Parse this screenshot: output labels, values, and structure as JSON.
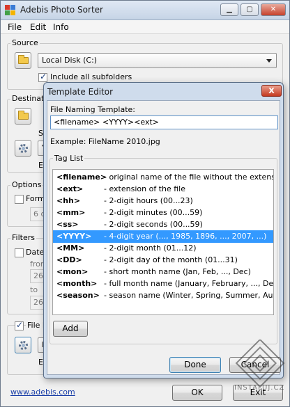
{
  "main_window": {
    "title": "Adebis Photo Sorter",
    "menu": [
      "File",
      "Edit",
      "Info"
    ],
    "source": {
      "group_label": "Source",
      "disk_value": "Local Disk (C:)",
      "include_subfolders_label": "Include all subfolders",
      "include_subfolders_checked": true
    },
    "destination": {
      "group_label": "Destinati",
      "s_label": "S",
      "e_label": "E",
      "y_label": "Y"
    },
    "options": {
      "group_label": "Options",
      "form_label": "Form",
      "days_value": "6 d"
    },
    "filters": {
      "group_label": "Filters",
      "date_label": "Date",
      "from_label": "from",
      "from_value": "26.0",
      "to_label": "to",
      "to_value": "26.0"
    },
    "file_naming": {
      "checkbox_label": "File N",
      "checked": true,
      "r_label": "R",
      "e_label": "E"
    },
    "footer_link": "www.adebis.com",
    "ok_label": "OK",
    "exit_label": "Exit"
  },
  "dialog": {
    "title": "Template Editor",
    "close_glyph": "X",
    "template_label": "File Naming Template:",
    "template_value": "<filename> <YYYY><ext>",
    "example_text": "Example: FileName 2010.jpg",
    "tag_list_label": "Tag List",
    "tags": [
      {
        "key": "<filename>",
        "desc": "- original name of the file without the extension"
      },
      {
        "key": "<ext>",
        "desc": "- extension of the file"
      },
      {
        "key": "<hh>",
        "desc": "- 2-digit hours (00...23)"
      },
      {
        "key": "<mm>",
        "desc": "- 2-digit minutes (00...59)"
      },
      {
        "key": "<ss>",
        "desc": "- 2-digit seconds (00...59)"
      },
      {
        "key": "<YYYY>",
        "desc": "- 4-digit year (..., 1985, 1896, ..., 2007, ...)"
      },
      {
        "key": "<MM>",
        "desc": "- 2-digit month (01...12)"
      },
      {
        "key": "<DD>",
        "desc": "- 2-digit day of the month (01...31)"
      },
      {
        "key": "<mon>",
        "desc": "- short month name (Jan, Feb, ..., Dec)"
      },
      {
        "key": "<month>",
        "desc": "- full month name (January, February, ..., December)"
      },
      {
        "key": "<season>",
        "desc": "- season name (Winter, Spring, Summer, Autumn)"
      }
    ],
    "selected_tag_index": 5,
    "add_label": "Add",
    "done_label": "Done",
    "cancel_label": "Cancel"
  },
  "watermark_text": "INSTALUJ.CZ",
  "colors": {
    "selection": "#3399ff",
    "title_bar": "#c6d4e6",
    "dialog_frame": "#cfdcec",
    "close_button": "#c4391f"
  }
}
